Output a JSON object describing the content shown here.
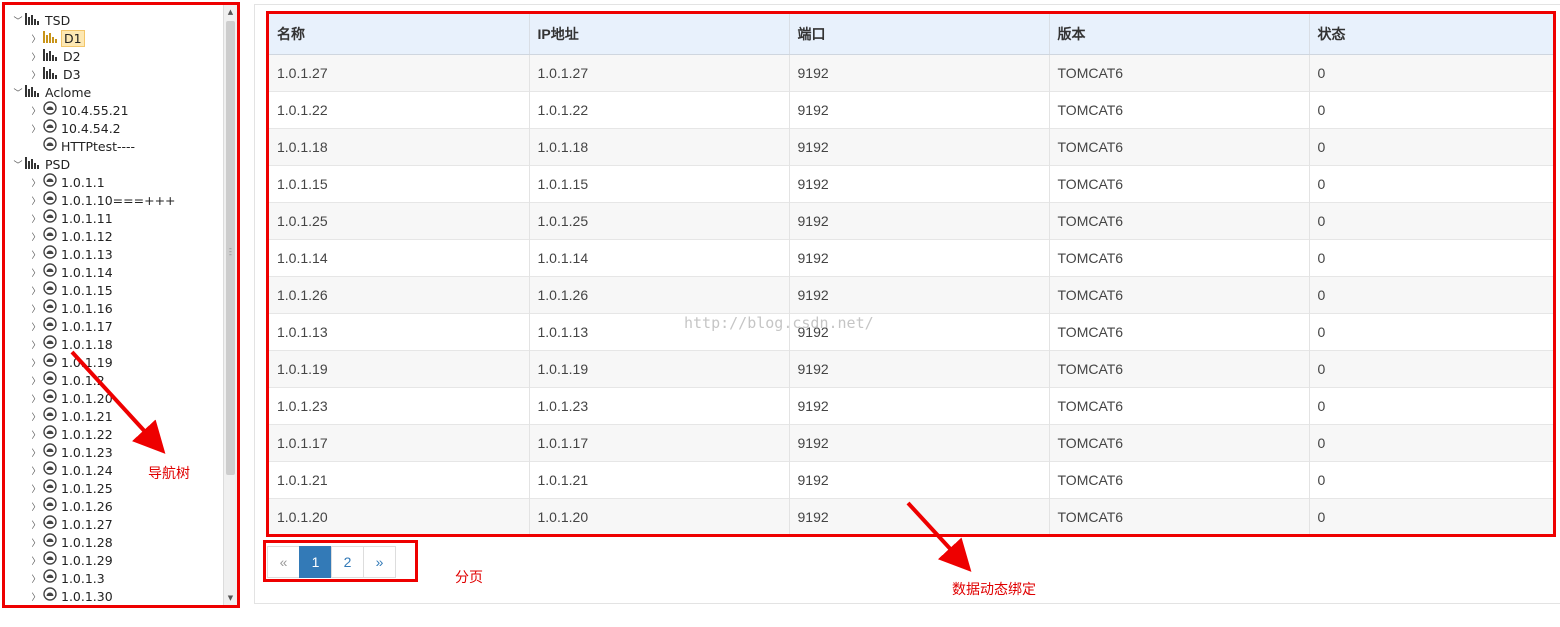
{
  "tree": {
    "nodes": [
      {
        "label": "TSD",
        "level": 0,
        "icon": "chart-icon",
        "toggle": "expanded"
      },
      {
        "label": "D1",
        "level": 1,
        "icon": "chart-icon",
        "toggle": "collapsed",
        "selected": true
      },
      {
        "label": "D2",
        "level": 1,
        "icon": "chart-icon",
        "toggle": "collapsed"
      },
      {
        "label": "D3",
        "level": 1,
        "icon": "chart-icon",
        "toggle": "collapsed"
      },
      {
        "label": "Aclome",
        "level": 0,
        "icon": "chart-icon",
        "toggle": "expanded"
      },
      {
        "label": "10.4.55.21",
        "level": 1,
        "icon": "server-icon",
        "toggle": "collapsed"
      },
      {
        "label": "10.4.54.2",
        "level": 1,
        "icon": "server-icon",
        "toggle": "collapsed"
      },
      {
        "label": "HTTPtest----",
        "level": 1,
        "icon": "server-icon",
        "toggle": "none"
      },
      {
        "label": "PSD",
        "level": 0,
        "icon": "chart-icon",
        "toggle": "expanded"
      },
      {
        "label": "1.0.1.1",
        "level": 1,
        "icon": "server-icon",
        "toggle": "collapsed"
      },
      {
        "label": "1.0.1.10===+++",
        "level": 1,
        "icon": "server-icon",
        "toggle": "collapsed"
      },
      {
        "label": "1.0.1.11",
        "level": 1,
        "icon": "server-icon",
        "toggle": "collapsed"
      },
      {
        "label": "1.0.1.12",
        "level": 1,
        "icon": "server-icon",
        "toggle": "collapsed"
      },
      {
        "label": "1.0.1.13",
        "level": 1,
        "icon": "server-icon",
        "toggle": "collapsed"
      },
      {
        "label": "1.0.1.14",
        "level": 1,
        "icon": "server-icon",
        "toggle": "collapsed"
      },
      {
        "label": "1.0.1.15",
        "level": 1,
        "icon": "server-icon",
        "toggle": "collapsed"
      },
      {
        "label": "1.0.1.16",
        "level": 1,
        "icon": "server-icon",
        "toggle": "collapsed"
      },
      {
        "label": "1.0.1.17",
        "level": 1,
        "icon": "server-icon",
        "toggle": "collapsed"
      },
      {
        "label": "1.0.1.18",
        "level": 1,
        "icon": "server-icon",
        "toggle": "collapsed"
      },
      {
        "label": "1.0.1.19",
        "level": 1,
        "icon": "server-icon",
        "toggle": "collapsed"
      },
      {
        "label": "1.0.1.2",
        "level": 1,
        "icon": "server-icon",
        "toggle": "collapsed"
      },
      {
        "label": "1.0.1.20",
        "level": 1,
        "icon": "server-icon",
        "toggle": "collapsed"
      },
      {
        "label": "1.0.1.21",
        "level": 1,
        "icon": "server-icon",
        "toggle": "collapsed"
      },
      {
        "label": "1.0.1.22",
        "level": 1,
        "icon": "server-icon",
        "toggle": "collapsed"
      },
      {
        "label": "1.0.1.23",
        "level": 1,
        "icon": "server-icon",
        "toggle": "collapsed"
      },
      {
        "label": "1.0.1.24",
        "level": 1,
        "icon": "server-icon",
        "toggle": "collapsed"
      },
      {
        "label": "1.0.1.25",
        "level": 1,
        "icon": "server-icon",
        "toggle": "collapsed"
      },
      {
        "label": "1.0.1.26",
        "level": 1,
        "icon": "server-icon",
        "toggle": "collapsed"
      },
      {
        "label": "1.0.1.27",
        "level": 1,
        "icon": "server-icon",
        "toggle": "collapsed"
      },
      {
        "label": "1.0.1.28",
        "level": 1,
        "icon": "server-icon",
        "toggle": "collapsed"
      },
      {
        "label": "1.0.1.29",
        "level": 1,
        "icon": "server-icon",
        "toggle": "collapsed"
      },
      {
        "label": "1.0.1.3",
        "level": 1,
        "icon": "server-icon",
        "toggle": "collapsed"
      },
      {
        "label": "1.0.1.30",
        "level": 1,
        "icon": "server-icon",
        "toggle": "collapsed"
      }
    ]
  },
  "table": {
    "columns": [
      "名称",
      "IP地址",
      "端口",
      "版本",
      "状态"
    ],
    "rows": [
      [
        "1.0.1.27",
        "1.0.1.27",
        "9192",
        "TOMCAT6",
        "0"
      ],
      [
        "1.0.1.22",
        "1.0.1.22",
        "9192",
        "TOMCAT6",
        "0"
      ],
      [
        "1.0.1.18",
        "1.0.1.18",
        "9192",
        "TOMCAT6",
        "0"
      ],
      [
        "1.0.1.15",
        "1.0.1.15",
        "9192",
        "TOMCAT6",
        "0"
      ],
      [
        "1.0.1.25",
        "1.0.1.25",
        "9192",
        "TOMCAT6",
        "0"
      ],
      [
        "1.0.1.14",
        "1.0.1.14",
        "9192",
        "TOMCAT6",
        "0"
      ],
      [
        "1.0.1.26",
        "1.0.1.26",
        "9192",
        "TOMCAT6",
        "0"
      ],
      [
        "1.0.1.13",
        "1.0.1.13",
        "9192",
        "TOMCAT6",
        "0"
      ],
      [
        "1.0.1.19",
        "1.0.1.19",
        "9192",
        "TOMCAT6",
        "0"
      ],
      [
        "1.0.1.23",
        "1.0.1.23",
        "9192",
        "TOMCAT6",
        "0"
      ],
      [
        "1.0.1.17",
        "1.0.1.17",
        "9192",
        "TOMCAT6",
        "0"
      ],
      [
        "1.0.1.21",
        "1.0.1.21",
        "9192",
        "TOMCAT6",
        "0"
      ],
      [
        "1.0.1.20",
        "1.0.1.20",
        "9192",
        "TOMCAT6",
        "0"
      ]
    ]
  },
  "pagination": {
    "prev_label": "«",
    "pages": [
      "1",
      "2"
    ],
    "active_page": "1",
    "next_label": "»"
  },
  "watermark": "http://blog.csdn.net/",
  "annotations": {
    "nav_tree": "导航树",
    "paging": "分页",
    "data_binding": "数据动态绑定"
  },
  "colors": {
    "annotation_red": "#ee0000",
    "header_bg": "#e8f1fc",
    "active_page_bg": "#337ab7",
    "selected_node_bg": "#fde8b3"
  }
}
